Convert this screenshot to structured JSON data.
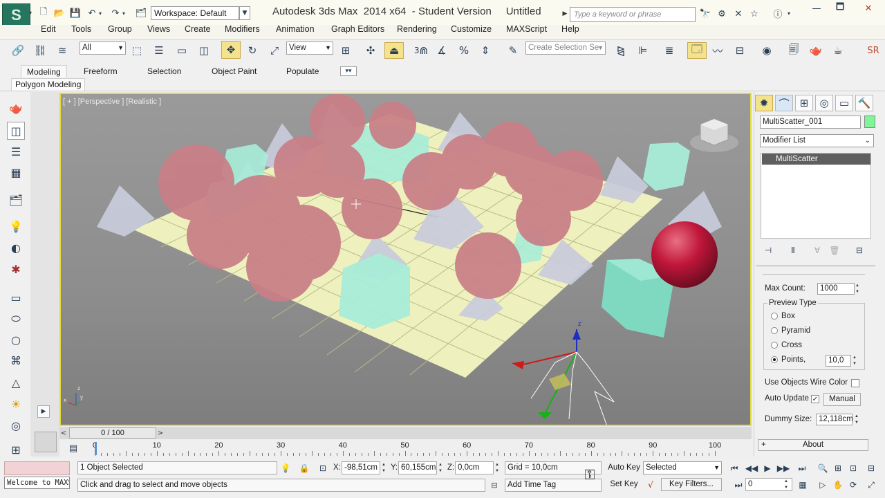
{
  "app": {
    "title": "Autodesk 3ds Max  2014 x64  - Student Version     Untitled",
    "workspace": "Workspace: Default",
    "search_placeholder": "Type a keyword or phrase",
    "logo_glyph": "S"
  },
  "menu": [
    "Edit",
    "Tools",
    "Group",
    "Views",
    "Create",
    "Modifiers",
    "Animation",
    "Graph Editors",
    "Rendering",
    "Customize",
    "MAXScript",
    "Help"
  ],
  "toolbar": {
    "selection_filter": "All",
    "ref_coord": "View",
    "named_selection_placeholder": "Create Selection Se",
    "snap_label": "3",
    "cut_label": "SR"
  },
  "ribbon": {
    "tabs": [
      "Modeling",
      "Freeform",
      "Selection",
      "Object Paint",
      "Populate"
    ],
    "active_tab": "Modeling",
    "panel": "Polygon Modeling"
  },
  "viewport": {
    "label": "[ + ] [Perspective ] [Realistic ]",
    "gizmo_axis_label": "z",
    "corner_axes": {
      "z": "z",
      "x": "x",
      "y": "y"
    }
  },
  "command_panel": {
    "object_name": "MultiScatter_001",
    "object_color": "#7ff59a",
    "modifier_list": "Modifier List",
    "stack_items": [
      "MultiScatter"
    ],
    "max_count_label": "Max Count:",
    "max_count": "1000",
    "preview_type_title": "Preview Type",
    "preview_options": [
      "Box",
      "Pyramid",
      "Cross",
      "Points,"
    ],
    "preview_selected": "Points,",
    "points_value": "10,0",
    "use_wire_label": "Use Objects Wire Color",
    "use_wire_checked": false,
    "auto_update_label": "Auto Update",
    "auto_update_checked": true,
    "manual_button": "Manual",
    "dummy_size_label": "Dummy Size:",
    "dummy_size": "12,118cm",
    "about_label": "About",
    "about_sign": "+"
  },
  "timeline": {
    "frame_display": "0 / 100",
    "current_frame": 0,
    "total_frames": 100,
    "ticks": [
      0,
      10,
      20,
      30,
      40,
      50,
      60,
      70,
      80,
      90,
      100
    ]
  },
  "status": {
    "welcome": "Welcome to MAXScript.",
    "selection": "1 Object Selected",
    "prompt": "Click and drag to select and move objects",
    "x_label": "X:",
    "x": "-98,51cm",
    "y_label": "Y:",
    "y": "60,155cm",
    "z_label": "Z:",
    "z": "0,0cm",
    "grid": "Grid = 10,0cm",
    "add_time_tag": "Add Time Tag",
    "auto_key": "Auto Key",
    "set_key": "Set Key",
    "key_mode": "Selected",
    "key_filters": "Key Filters...",
    "current_time": "0"
  }
}
